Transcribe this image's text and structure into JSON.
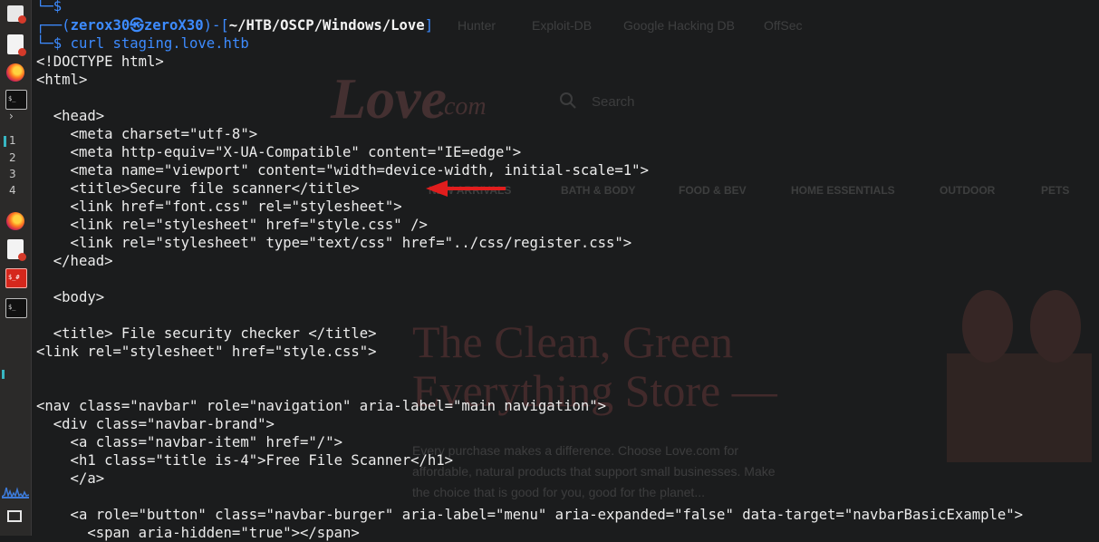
{
  "taskbar": {
    "workspaces": [
      "1",
      "2",
      "3",
      "4"
    ],
    "icons": [
      "document-icon",
      "firefox-icon",
      "terminal-icon",
      "chevron-right-icon",
      "firefox-icon",
      "document-icon",
      "root-terminal-icon",
      "terminal-icon",
      "network-graph-icon",
      "window-icon"
    ],
    "term_icon_text": "$_",
    "root_term_icon_text": "$_#",
    "chevron": "›"
  },
  "background_browser": {
    "bookmarks": [
      "Hunter",
      "Exploit-DB",
      "Google Hacking DB",
      "OffSec"
    ],
    "logo": "Love",
    "logo_suffix": ".com",
    "search_placeholder": "Search",
    "nav_items": [
      "NEW ARRIVALS",
      "BATH & BODY",
      "FOOD & BEV",
      "HOME ESSENTIALS",
      "OUTDOOR",
      "PETS"
    ],
    "hero_line1": "The Clean, Green",
    "hero_line2": "Everything Store —",
    "paragraph": "Every purchase makes a difference. Choose Love.com for affordable, natural products that support small businesses. Make the choice that is good for you, good for the planet..."
  },
  "terminal": {
    "prev_prompt_tail": "└─$",
    "prompt": {
      "open": "┌──(",
      "user": "zerox30㉿zeroX30",
      "mid": ")-[",
      "dir": "~/HTB/OSCP/Windows/Love",
      "close": "]",
      "marker": "└─$",
      "command": "curl staging.love.htb"
    },
    "output": [
      "<!DOCTYPE html>",
      "<html>",
      "",
      "  <head>",
      "    <meta charset=\"utf-8\">",
      "    <meta http-equiv=\"X-UA-Compatible\" content=\"IE=edge\">",
      "    <meta name=\"viewport\" content=\"width=device-width, initial-scale=1\">",
      "    <title>Secure file scanner</title>",
      "    <link href=\"font.css\" rel=\"stylesheet\">",
      "    <link rel=\"stylesheet\" href=\"style.css\" />",
      "    <link rel=\"stylesheet\" type=\"text/css\" href=\"../css/register.css\">",
      "  </head>",
      "",
      "  <body>",
      "",
      "  <title> File security checker </title>",
      "<link rel=\"stylesheet\" href=\"style.css\">",
      "",
      "",
      "<nav class=\"navbar\" role=\"navigation\" aria-label=\"main navigation\">",
      "  <div class=\"navbar-brand\">",
      "    <a class=\"navbar-item\" href=\"/\">",
      "    <h1 class=\"title is-4\">Free File Scanner</h1>",
      "    </a>",
      "",
      "    <a role=\"button\" class=\"navbar-burger\" aria-label=\"menu\" aria-expanded=\"false\" data-target=\"navbarBasicExample\">",
      "      <span aria-hidden=\"true\"></span>"
    ],
    "annotation": "red-arrow-icon"
  },
  "colors": {
    "terminal_bg": "#1b1c1d",
    "prompt_blue": "#3d8bff",
    "text": "#ececec",
    "arrow_red": "#e11d1d"
  }
}
